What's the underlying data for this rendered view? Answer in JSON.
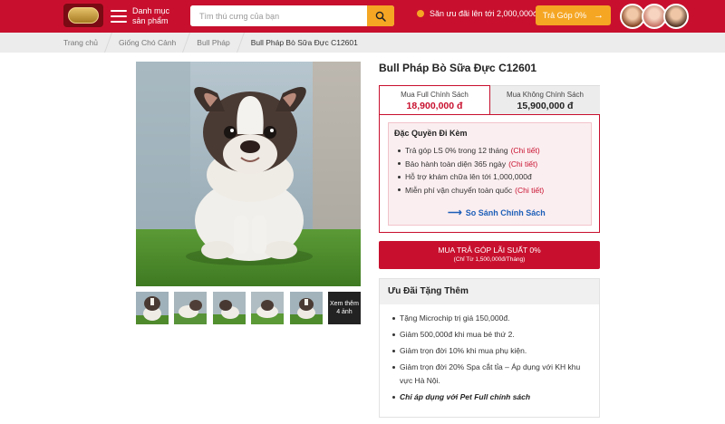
{
  "header": {
    "menu_label": "Danh mục sản phẩm",
    "search_placeholder": "Tìm thú cưng của bạn",
    "promo_text": "Săn ưu đãi lên tới 2,000,000đ",
    "installment_label": "Trả Góp 0%",
    "colors": {
      "primary": "#c8102e",
      "accent": "#f5a623"
    }
  },
  "breadcrumb": {
    "items": [
      "Trang chủ",
      "Giống Chó Cảnh",
      "Bull Pháp",
      "Bull Pháp Bò Sữa Đực C12601"
    ]
  },
  "gallery": {
    "thumbnail_count": 5,
    "more_label": "Xem thêm 4 ảnh"
  },
  "product": {
    "title": "Bull Pháp Bò Sữa Đực C12601",
    "tabs": [
      {
        "label": "Mua Full Chính Sách",
        "price": "18,900,000 đ",
        "active": true
      },
      {
        "label": "Mua Không Chính Sách",
        "price": "15,900,000 đ",
        "active": false
      }
    ],
    "benefits": {
      "title": "Đặc Quyền Đi Kèm",
      "items": [
        {
          "text": "Trả góp LS 0% trong 12 tháng",
          "link": "(Chi tiết)"
        },
        {
          "text": "Bảo hành toàn diện 365 ngày",
          "link": "(Chi tiết)"
        },
        {
          "text": "Hỗ trợ khám chữa lên tới 1,000,000đ",
          "link": ""
        },
        {
          "text": "Miễn phí vận chuyển toàn quốc",
          "link": "(Chi tiết)"
        }
      ],
      "compare_label": "So Sánh Chính Sách"
    },
    "buy_button": {
      "label": "MUA TRẢ GÓP LÃI SUẤT 0%",
      "sublabel": "(Chỉ Từ 1,500,000đ/Tháng)"
    },
    "gifts": {
      "title": "Ưu Đãi Tặng Thêm",
      "items": [
        "Tặng Microchip trị giá 150,000đ.",
        "Giảm 500,000đ khi mua bé thứ 2.",
        "Giảm trọn đời 10% khi mua phụ kiện.",
        "Giảm trọn đời 20% Spa cắt tỉa – Áp dụng với KH khu vực Hà Nội."
      ],
      "note": "Chỉ áp dụng với Pet Full chính sách"
    }
  }
}
